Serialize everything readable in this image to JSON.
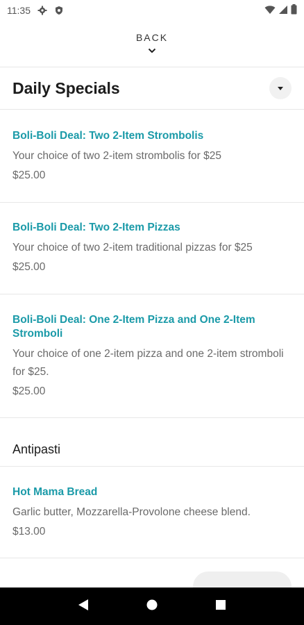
{
  "status_bar": {
    "time": "11:35"
  },
  "header": {
    "back_label": "BACK"
  },
  "section": {
    "title": "Daily Specials"
  },
  "items": [
    {
      "name": "Boli-Boli Deal: Two 2-Item Strombolis",
      "description": "Your choice of two 2-item strombolis for $25",
      "price": "$25.00"
    },
    {
      "name": "Boli-Boli Deal: Two 2-Item Pizzas",
      "description": "Your choice of two 2-item traditional pizzas for $25",
      "price": "$25.00"
    },
    {
      "name": "Boli-Boli Deal: One 2-Item Pizza and One 2-Item Stromboli",
      "description": "Your choice of one 2-item pizza and one 2-item stromboli for $25.",
      "price": "$25.00"
    }
  ],
  "category": {
    "label": "Antipasti"
  },
  "antipasti_items": [
    {
      "name": "Hot Mama Bread",
      "description": "Garlic butter, Mozzarella-Provolone cheese blend.",
      "price": "$13.00"
    }
  ],
  "icons": {
    "status_left": [
      "gear-icon",
      "shield-icon"
    ],
    "status_right": [
      "wifi-icon",
      "signal-icon",
      "battery-icon"
    ],
    "nav": [
      "back-triangle-icon",
      "home-circle-icon",
      "recents-square-icon"
    ]
  }
}
